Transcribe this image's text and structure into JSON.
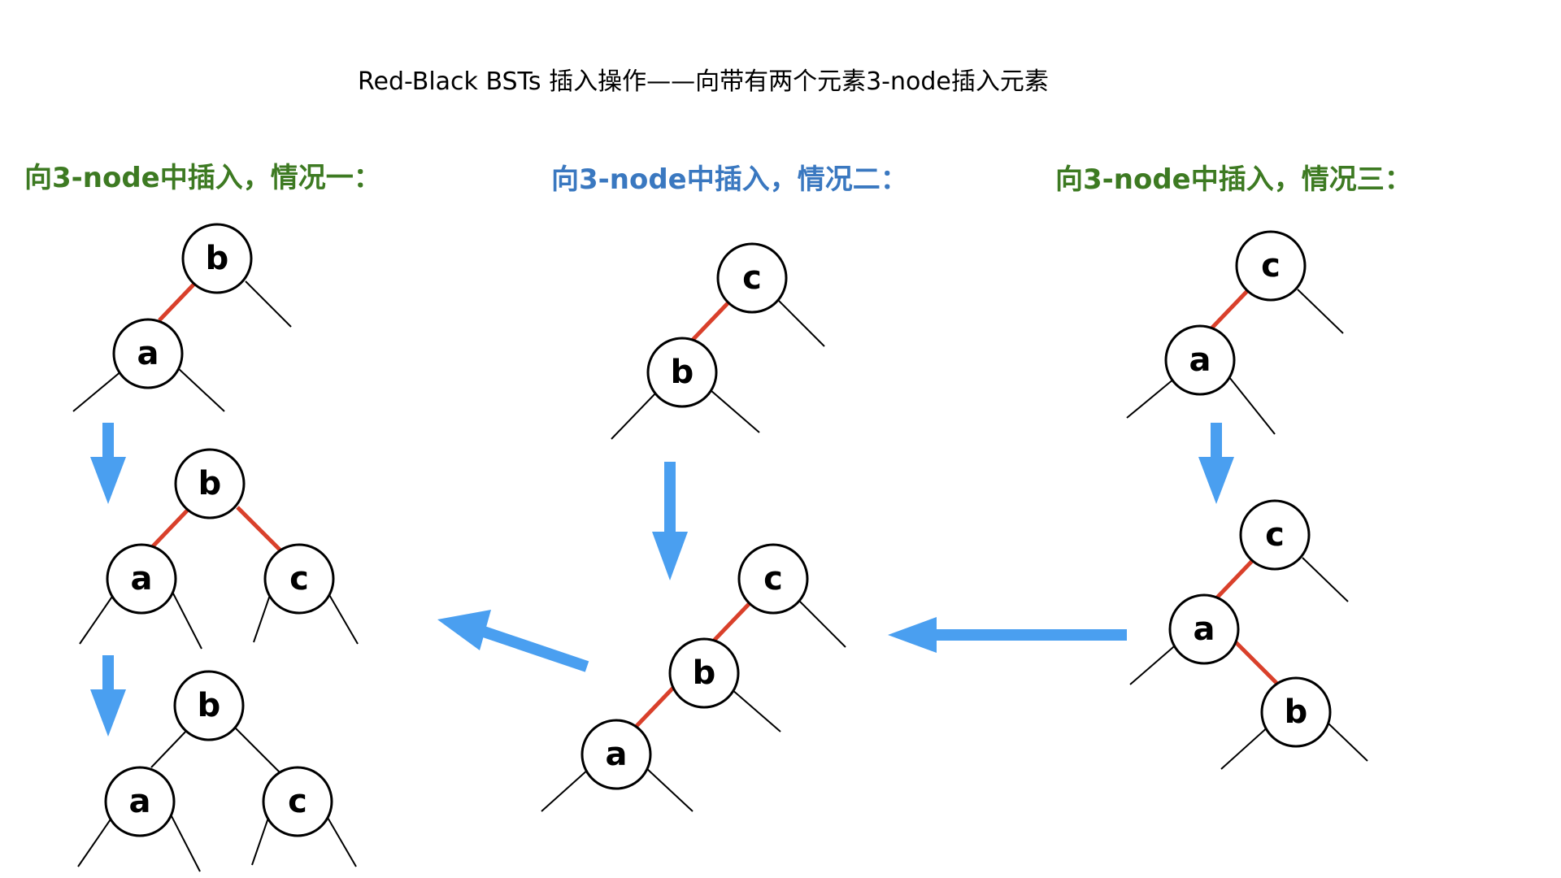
{
  "title": "Red-Black BSTs 插入操作——向带有两个元素3-node插入元素",
  "colors": {
    "red_link": "#d9402b",
    "arrow": "#4a9ff0",
    "green_heading": "#3d7a22",
    "blue_heading": "#3a78c0"
  },
  "cases": [
    {
      "heading": "向3-node中插入，情况一：",
      "color": "green"
    },
    {
      "heading": "向3-node中插入，情况二：",
      "color": "blue"
    },
    {
      "heading": "向3-node中插入，情况三：",
      "color": "green"
    }
  ],
  "nodes": {
    "case1_step1_b": "b",
    "case1_step1_a": "a",
    "case1_step2_b": "b",
    "case1_step2_a": "a",
    "case1_step2_c": "c",
    "case1_step3_b": "b",
    "case1_step3_a": "a",
    "case1_step3_c": "c",
    "case2_step1_c": "c",
    "case2_step1_b": "b",
    "case2_step2_c": "c",
    "case2_step2_b": "b",
    "case2_step2_a": "a",
    "case3_step1_c": "c",
    "case3_step1_a": "a",
    "case3_step2_c": "c",
    "case3_step2_a": "a",
    "case3_step2_b": "b"
  }
}
